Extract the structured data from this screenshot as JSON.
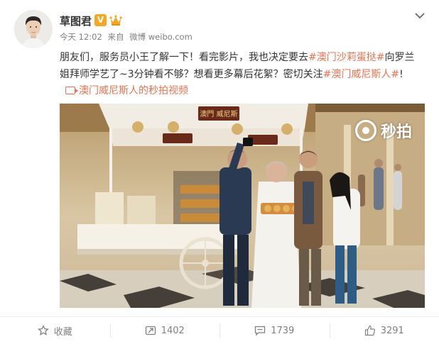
{
  "user": {
    "name": "草图君",
    "verified_badge": "V",
    "badge_icon": "crown-icon"
  },
  "meta": {
    "time": "今天 12:02",
    "from_label": "来自",
    "source": "微博 weibo.com"
  },
  "post": {
    "line1_text": "朋友们，服务员小王了解一下！看完影片，我也决定要去",
    "line1_tag": "#澳门沙莉蛋挞#",
    "line1_tail": "向罗兰",
    "line2_text": "姐拜师学艺了~3分钟看不够？想看更多幕后花絮？密切关注",
    "line2_tag": "#澳门威尼斯人#",
    "line2_tail": "!",
    "video_link": "澳门威尼斯人的秒拍视频"
  },
  "video": {
    "watermark": "秒拍",
    "stall_sign": "澳門 威尼斯"
  },
  "footer": {
    "favorite_label": "收藏",
    "repost_count": "1402",
    "comment_count": "1739",
    "like_count": "3291"
  },
  "colors": {
    "link": "#eb7350",
    "meta_gray": "#808080",
    "text": "#333333",
    "badge": "#f5a623"
  }
}
